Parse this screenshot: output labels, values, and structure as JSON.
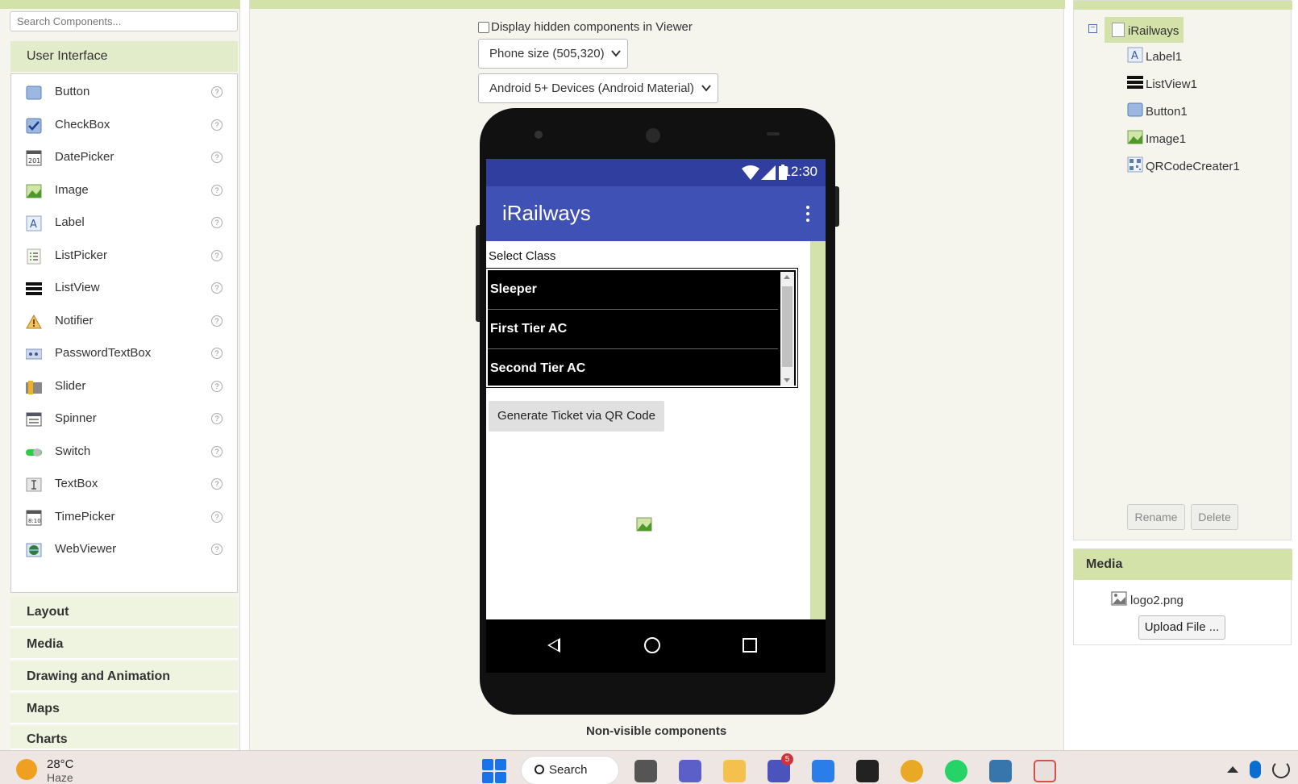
{
  "palette": {
    "search_placeholder": "Search Components...",
    "header": "User Interface",
    "items": [
      {
        "label": "Button",
        "icon": "button-icon"
      },
      {
        "label": "CheckBox",
        "icon": "checkbox-icon"
      },
      {
        "label": "DatePicker",
        "icon": "datepicker-icon"
      },
      {
        "label": "Image",
        "icon": "image-icon"
      },
      {
        "label": "Label",
        "icon": "label-icon"
      },
      {
        "label": "ListPicker",
        "icon": "listpicker-icon"
      },
      {
        "label": "ListView",
        "icon": "listview-icon"
      },
      {
        "label": "Notifier",
        "icon": "notifier-icon"
      },
      {
        "label": "PasswordTextBox",
        "icon": "passwordtextbox-icon"
      },
      {
        "label": "Slider",
        "icon": "slider-icon"
      },
      {
        "label": "Spinner",
        "icon": "spinner-icon"
      },
      {
        "label": "Switch",
        "icon": "switch-icon"
      },
      {
        "label": "TextBox",
        "icon": "textbox-icon"
      },
      {
        "label": "TimePicker",
        "icon": "timepicker-icon"
      },
      {
        "label": "WebViewer",
        "icon": "webviewer-icon"
      }
    ],
    "help_glyph": "?",
    "categories": [
      "Layout",
      "Media",
      "Drawing and Animation",
      "Maps",
      "Charts"
    ]
  },
  "viewer": {
    "checkbox_label": "Display hidden components in Viewer",
    "size_select": "Phone size (505,320)",
    "theme_select": "Android 5+ Devices (Android Material)",
    "non_visible_label": "Non-visible components"
  },
  "phone": {
    "time": "12:30",
    "app_title": "iRailways",
    "select_label": "Select Class",
    "list_items": [
      "Sleeper",
      "First Tier AC",
      "Second Tier AC"
    ],
    "button_label": "Generate Ticket via QR Code",
    "colors": {
      "status": "#303f9f",
      "appbar": "#3f51b5"
    }
  },
  "tree": {
    "root": "iRailways",
    "children": [
      {
        "label": "Label1",
        "icon": "label-icon"
      },
      {
        "label": "ListView1",
        "icon": "listview-icon"
      },
      {
        "label": "Button1",
        "icon": "button-icon"
      },
      {
        "label": "Image1",
        "icon": "image-icon"
      },
      {
        "label": "QRCodeCreater1",
        "icon": "qrcode-icon"
      }
    ],
    "rename": "Rename",
    "delete": "Delete"
  },
  "media": {
    "header": "Media",
    "file": "logo2.png",
    "upload": "Upload File ..."
  },
  "taskbar": {
    "temp": "28°C",
    "condition": "Haze",
    "search": "Search",
    "teams_badge": "5"
  }
}
